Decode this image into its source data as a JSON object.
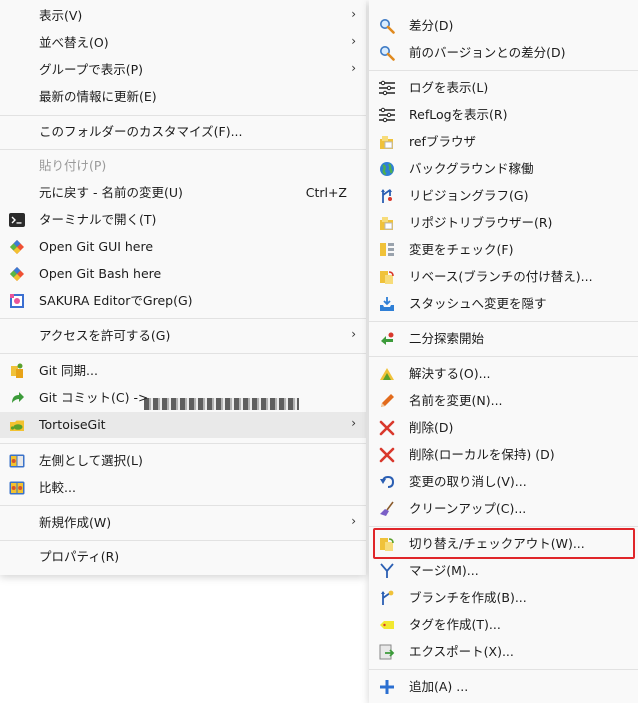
{
  "left_menu": {
    "items": [
      {
        "label": "表示(V)",
        "submenu": true
      },
      {
        "label": "並べ替え(O)",
        "submenu": true
      },
      {
        "label": "グループで表示(P)",
        "submenu": true
      },
      {
        "label": "最新の情報に更新(E)"
      },
      {
        "label": "このフォルダーのカスタマイズ(F)..."
      },
      {
        "label": "貼り付け(P)",
        "disabled": true
      },
      {
        "label": "元に戻す - 名前の変更(U)",
        "shortcut": "Ctrl+Z"
      },
      {
        "label": "ターミナルで開く(T)",
        "icon": "terminal-icon"
      },
      {
        "label": "Open Git GUI here",
        "icon": "git-gui-icon"
      },
      {
        "label": "Open Git Bash here",
        "icon": "git-bash-icon"
      },
      {
        "label": "SAKURA EditorでGrep(G)",
        "icon": "sakura-editor-icon"
      },
      {
        "label": "アクセスを許可する(G)",
        "submenu": true
      },
      {
        "label": "Git 同期...",
        "icon": "git-sync-icon"
      },
      {
        "label": "Git コミット(C) ->",
        "icon": "git-commit-icon"
      },
      {
        "label": "TortoiseGit",
        "icon": "tortoisegit-icon",
        "submenu": true
      },
      {
        "label": "左側として選択(L)",
        "icon": "select-left-icon"
      },
      {
        "label": "比較...",
        "icon": "compare-icon"
      },
      {
        "label": "新規作成(W)",
        "submenu": true
      },
      {
        "label": "プロパティ(R)"
      }
    ]
  },
  "right_menu": {
    "items": [
      {
        "label": "差分(D)",
        "icon": "magnifier-icon"
      },
      {
        "label": "前のバージョンとの差分(D)",
        "icon": "magnifier-icon"
      },
      {
        "label": "ログを表示(L)",
        "icon": "log-icon"
      },
      {
        "label": "RefLogを表示(R)",
        "icon": "reflog-icon"
      },
      {
        "label": "refブラウザ",
        "icon": "ref-browser-icon"
      },
      {
        "label": "バックグラウンド稼働",
        "icon": "globe-icon"
      },
      {
        "label": "リビジョングラフ(G)",
        "icon": "revision-graph-icon"
      },
      {
        "label": "リポジトリブラウザー(R)",
        "icon": "repo-browser-icon"
      },
      {
        "label": "変更をチェック(F)",
        "icon": "check-changes-icon"
      },
      {
        "label": "リベース(ブランチの付け替え)...",
        "icon": "rebase-icon"
      },
      {
        "label": "スタッシュへ変更を隠す",
        "icon": "stash-icon"
      },
      {
        "label": "二分探索開始",
        "icon": "bisect-icon"
      },
      {
        "label": "解決する(O)...",
        "icon": "resolve-icon"
      },
      {
        "label": "名前を変更(N)...",
        "icon": "rename-icon"
      },
      {
        "label": "削除(D)",
        "icon": "delete-icon"
      },
      {
        "label": "削除(ローカルを保持) (D)",
        "icon": "delete-keep-local-icon"
      },
      {
        "label": "変更の取り消し(V)...",
        "icon": "revert-icon"
      },
      {
        "label": "クリーンアップ(C)...",
        "icon": "cleanup-icon"
      },
      {
        "label": "切り替え/チェックアウト(W)...",
        "icon": "switch-checkout-icon",
        "highlighted": true
      },
      {
        "label": "マージ(M)...",
        "icon": "merge-icon"
      },
      {
        "label": "ブランチを作成(B)...",
        "icon": "branch-icon"
      },
      {
        "label": "タグを作成(T)...",
        "icon": "tag-icon"
      },
      {
        "label": "エクスポート(X)...",
        "icon": "export-icon"
      },
      {
        "label": "追加(A) ...",
        "icon": "add-icon"
      }
    ]
  },
  "arrow_glyph": "›",
  "colors": {
    "highlight_border": "#e0262a",
    "menu_bg": "#f9f9f9",
    "separator": "#e2e2e2",
    "disabled_text": "#9a9a9a"
  }
}
